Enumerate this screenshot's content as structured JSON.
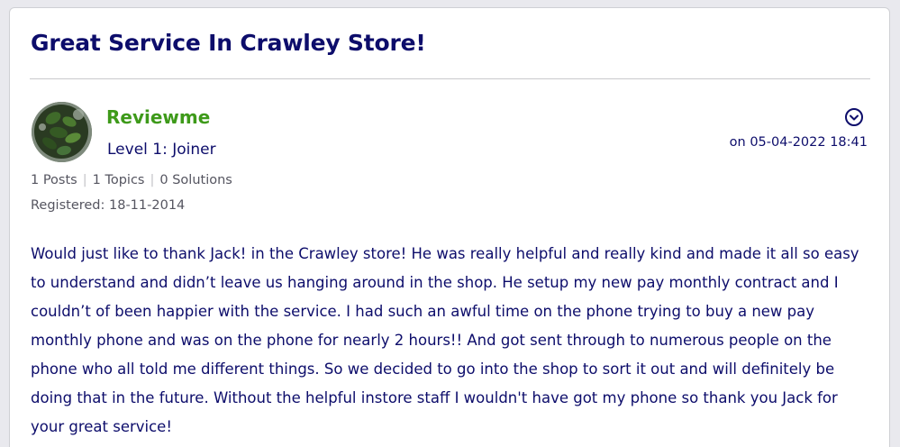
{
  "post": {
    "title": "Great Service In Crawley Store!",
    "author": {
      "username": "Reviewme",
      "rank": "Level 1: Joiner",
      "avatar_icon": "avatar-plant-photo",
      "stats": {
        "posts": "1 Posts",
        "topics": "1 Topics",
        "solutions": "0 Solutions"
      },
      "registered": "Registered: 18-11-2014"
    },
    "date": "on 05-04-2022 18:41",
    "menu_icon": "chevron-down-circle-icon",
    "body": "Would just like to thank Jack! in the Crawley store! He was really helpful and really kind and made it all so easy to understand and didn’t leave us hanging around in the shop. He setup my new pay monthly contract and I couldn’t of been happier with the service. I had such an awful time on the phone trying to buy a new pay monthly phone and was on the phone for nearly 2 hours!! And got sent through to numerous people on the phone who all told me different things. So we decided to go into the shop to sort it out and will definitely be doing that in the future. Without the helpful instore  staff I wouldn't have got my phone so thank you Jack for your great service!"
  },
  "colors": {
    "title": "#0d0d6b",
    "username": "#3e9a1a",
    "meta": "#555560",
    "divider": "#c9c9cc"
  }
}
